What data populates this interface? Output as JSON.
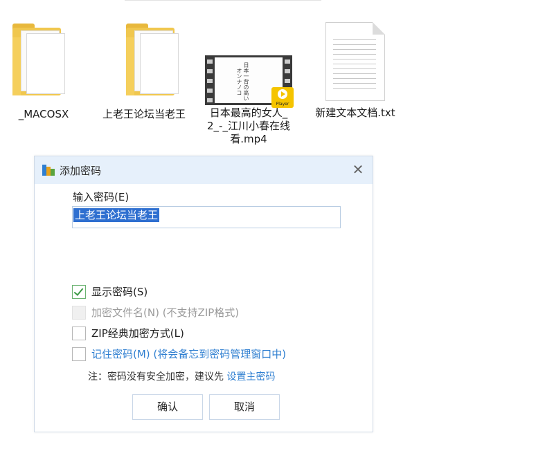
{
  "files": [
    {
      "label": "_MACOSX",
      "icon": "folder-icon"
    },
    {
      "label": "上老王论坛当老王",
      "icon": "folder-icon"
    },
    {
      "label": "日本最高的女人_2_-_江川小春在线看.mp4",
      "icon": "video-file-icon",
      "thumb_title": "日本一背の高いオンナノコ",
      "badge": "Player"
    },
    {
      "label": "新建文本文档.txt",
      "icon": "text-document-icon"
    }
  ],
  "dialog": {
    "title": "添加密码",
    "close_glyph": "✕",
    "input_label": "输入密码(E)",
    "password_value": "上老王论坛当老王",
    "options": {
      "show_password": {
        "label": "显示密码(S)",
        "checked": true
      },
      "encrypt_names": {
        "label": "加密文件名(N) (不支持ZIP格式)",
        "checked": false,
        "disabled": true
      },
      "zip_classic": {
        "label": "ZIP经典加密方式(L)",
        "checked": false
      },
      "remember": {
        "label": "记住密码(M) (将会备忘到密码管理窗口中)",
        "checked": false
      }
    },
    "note_prefix": "注：密码没有安全加密，建议先",
    "note_link": "设置主密码",
    "ok_label": "确认",
    "cancel_label": "取消"
  },
  "colors": {
    "accent": "#2f7fd1",
    "titlebar": "#e6f0fb",
    "folder": "#f0c74e",
    "selection": "#2e6fd0"
  }
}
